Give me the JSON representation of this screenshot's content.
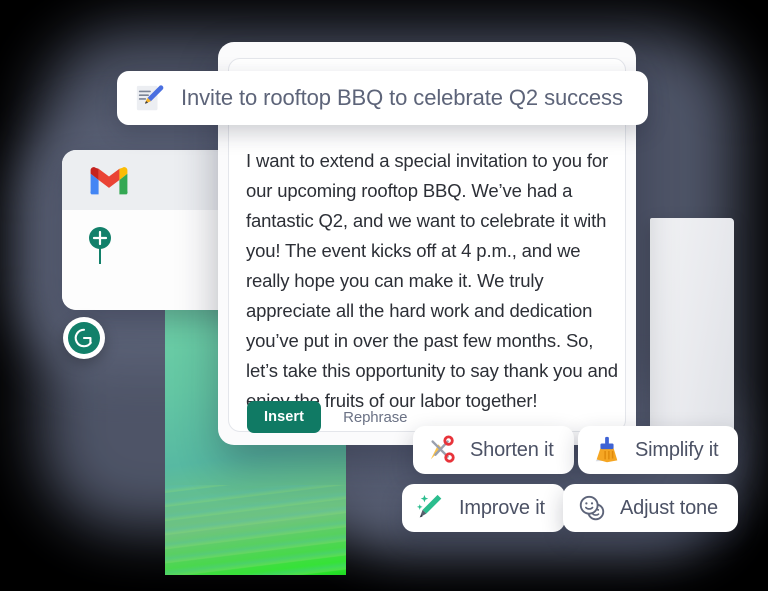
{
  "background": {
    "shadow_color": "#5c6378",
    "canvas_color": "#000000",
    "green_panel_gradient_from": "#6ecfa6",
    "green_panel_gradient_to": "#1ed922"
  },
  "gmail_card": {
    "name": "gmail-compose-card",
    "logo_icon": "gmail-logo-icon",
    "pin_icon": "location-pin-plus-icon"
  },
  "grammarly_badge": {
    "icon": "grammarly-logo-icon",
    "brand_color": "#12806a"
  },
  "prompt": {
    "icon": "memo-pen-emoji-icon",
    "text": "Invite to rooftop BBQ to celebrate Q2 success",
    "text_color": "#5d6479"
  },
  "generated_text": {
    "body": "I want to extend a special invitation to you for our upcoming rooftop BBQ. We’ve had a fantastic Q2, and we want to celebrate it with you! The event kicks off at 4 p.m., and we really hope you can make it. We truly appreciate all the hard work and dedication you’ve put in over the past few months. So, let’s take this opportunity to say thank you and enjoy the fruits of our labor together!"
  },
  "actions": {
    "insert_label": "Insert",
    "insert_color": "#107a64",
    "rephrase_label": "Rephrase"
  },
  "suggestion_chips": [
    {
      "id": "shorten",
      "label": "Shorten it",
      "icon": "scissors-icon"
    },
    {
      "id": "simplify",
      "label": "Simplify it",
      "icon": "broom-icon"
    },
    {
      "id": "improve",
      "label": "Improve it",
      "icon": "sparkle-pencil-icon"
    },
    {
      "id": "adjust",
      "label": "Adjust tone",
      "icon": "smiley-faces-icon"
    }
  ]
}
